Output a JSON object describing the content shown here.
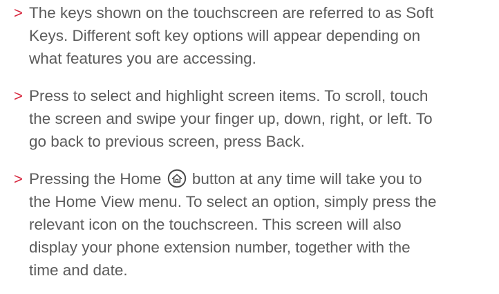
{
  "bullet_glyph": ">",
  "bullet_color": "#d7263d",
  "text_color": "#5b5b5b",
  "items": [
    {
      "lines": [
        "The keys shown on the touchscreen are referred to as Soft",
        "Keys. Different soft key options will appear depending on",
        "what features you are accessing."
      ]
    },
    {
      "lines": [
        "Press to select and highlight screen items. To scroll, touch",
        "the screen and swipe your finger up, down, right, or left. To",
        "go back to previous screen, press Back."
      ]
    },
    {
      "first_line_before_icon": "Pressing the Home",
      "icon": "home-icon",
      "first_line_after_icon": "button at any time will take you to",
      "lines": [
        "the Home View menu. To select an option, simply press the",
        "relevant icon on the touchscreen. This screen will also",
        "display your phone extension number, together with the",
        "time and date."
      ]
    }
  ]
}
